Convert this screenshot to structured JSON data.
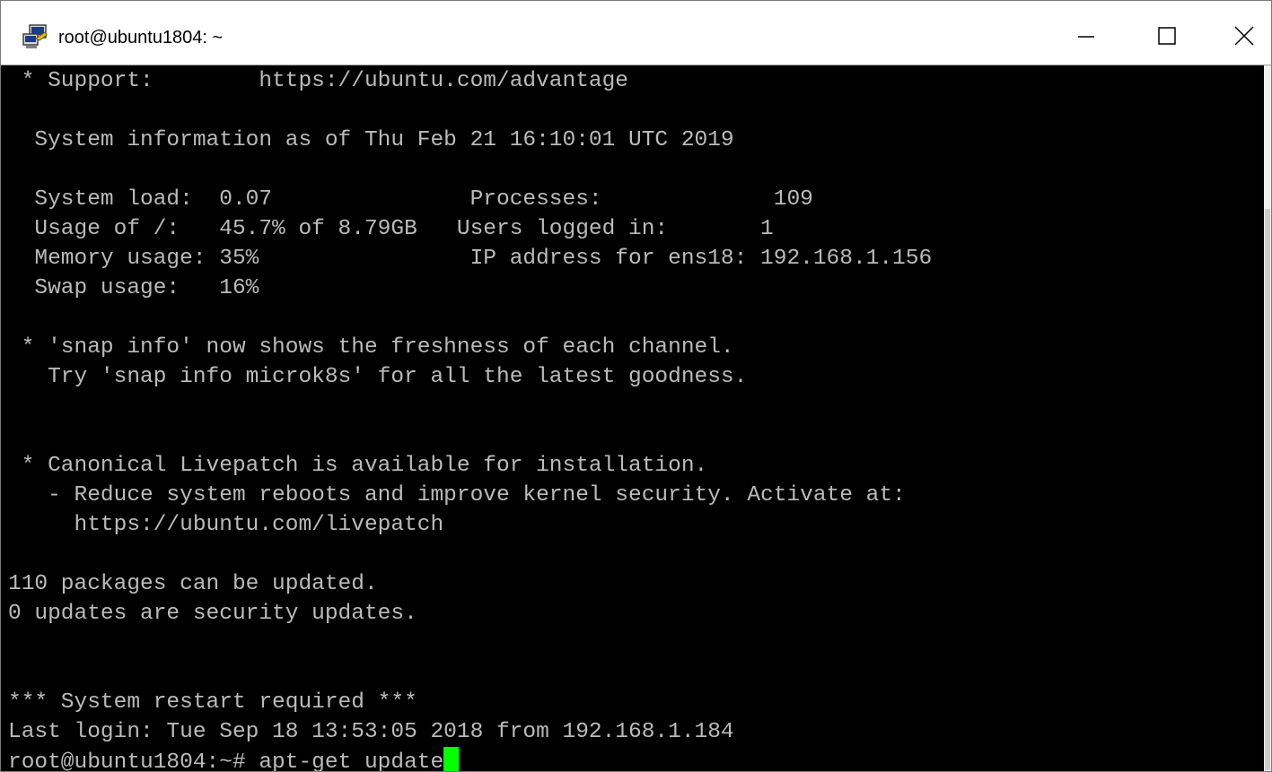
{
  "window": {
    "title": "root@ubuntu1804: ~",
    "icon": "putty-icon",
    "controls": [
      "minimize-icon",
      "maximize-icon",
      "close-icon"
    ]
  },
  "terminal": {
    "lines": [
      " * Support:        https://ubuntu.com/advantage",
      "",
      "  System information as of Thu Feb 21 16:10:01 UTC 2019",
      "",
      "  System load:  0.07               Processes:             109",
      "  Usage of /:   45.7% of 8.79GB   Users logged in:       1",
      "  Memory usage: 35%                IP address for ens18: 192.168.1.156",
      "  Swap usage:   16%",
      "",
      " * 'snap info' now shows the freshness of each channel.",
      "   Try 'snap info microk8s' for all the latest goodness.",
      "",
      "",
      " * Canonical Livepatch is available for installation.",
      "   - Reduce system reboots and improve kernel security. Activate at:",
      "     https://ubuntu.com/livepatch",
      "",
      "110 packages can be updated.",
      "0 updates are security updates.",
      "",
      "",
      "*** System restart required ***",
      "Last login: Tue Sep 18 13:53:05 2018 from 192.168.1.184"
    ],
    "prompt": "root@ubuntu1804:~# ",
    "command": "apt-get update",
    "cursor_color": "#00ff00",
    "text_color": "#bbbbbb",
    "background": "#000000"
  }
}
